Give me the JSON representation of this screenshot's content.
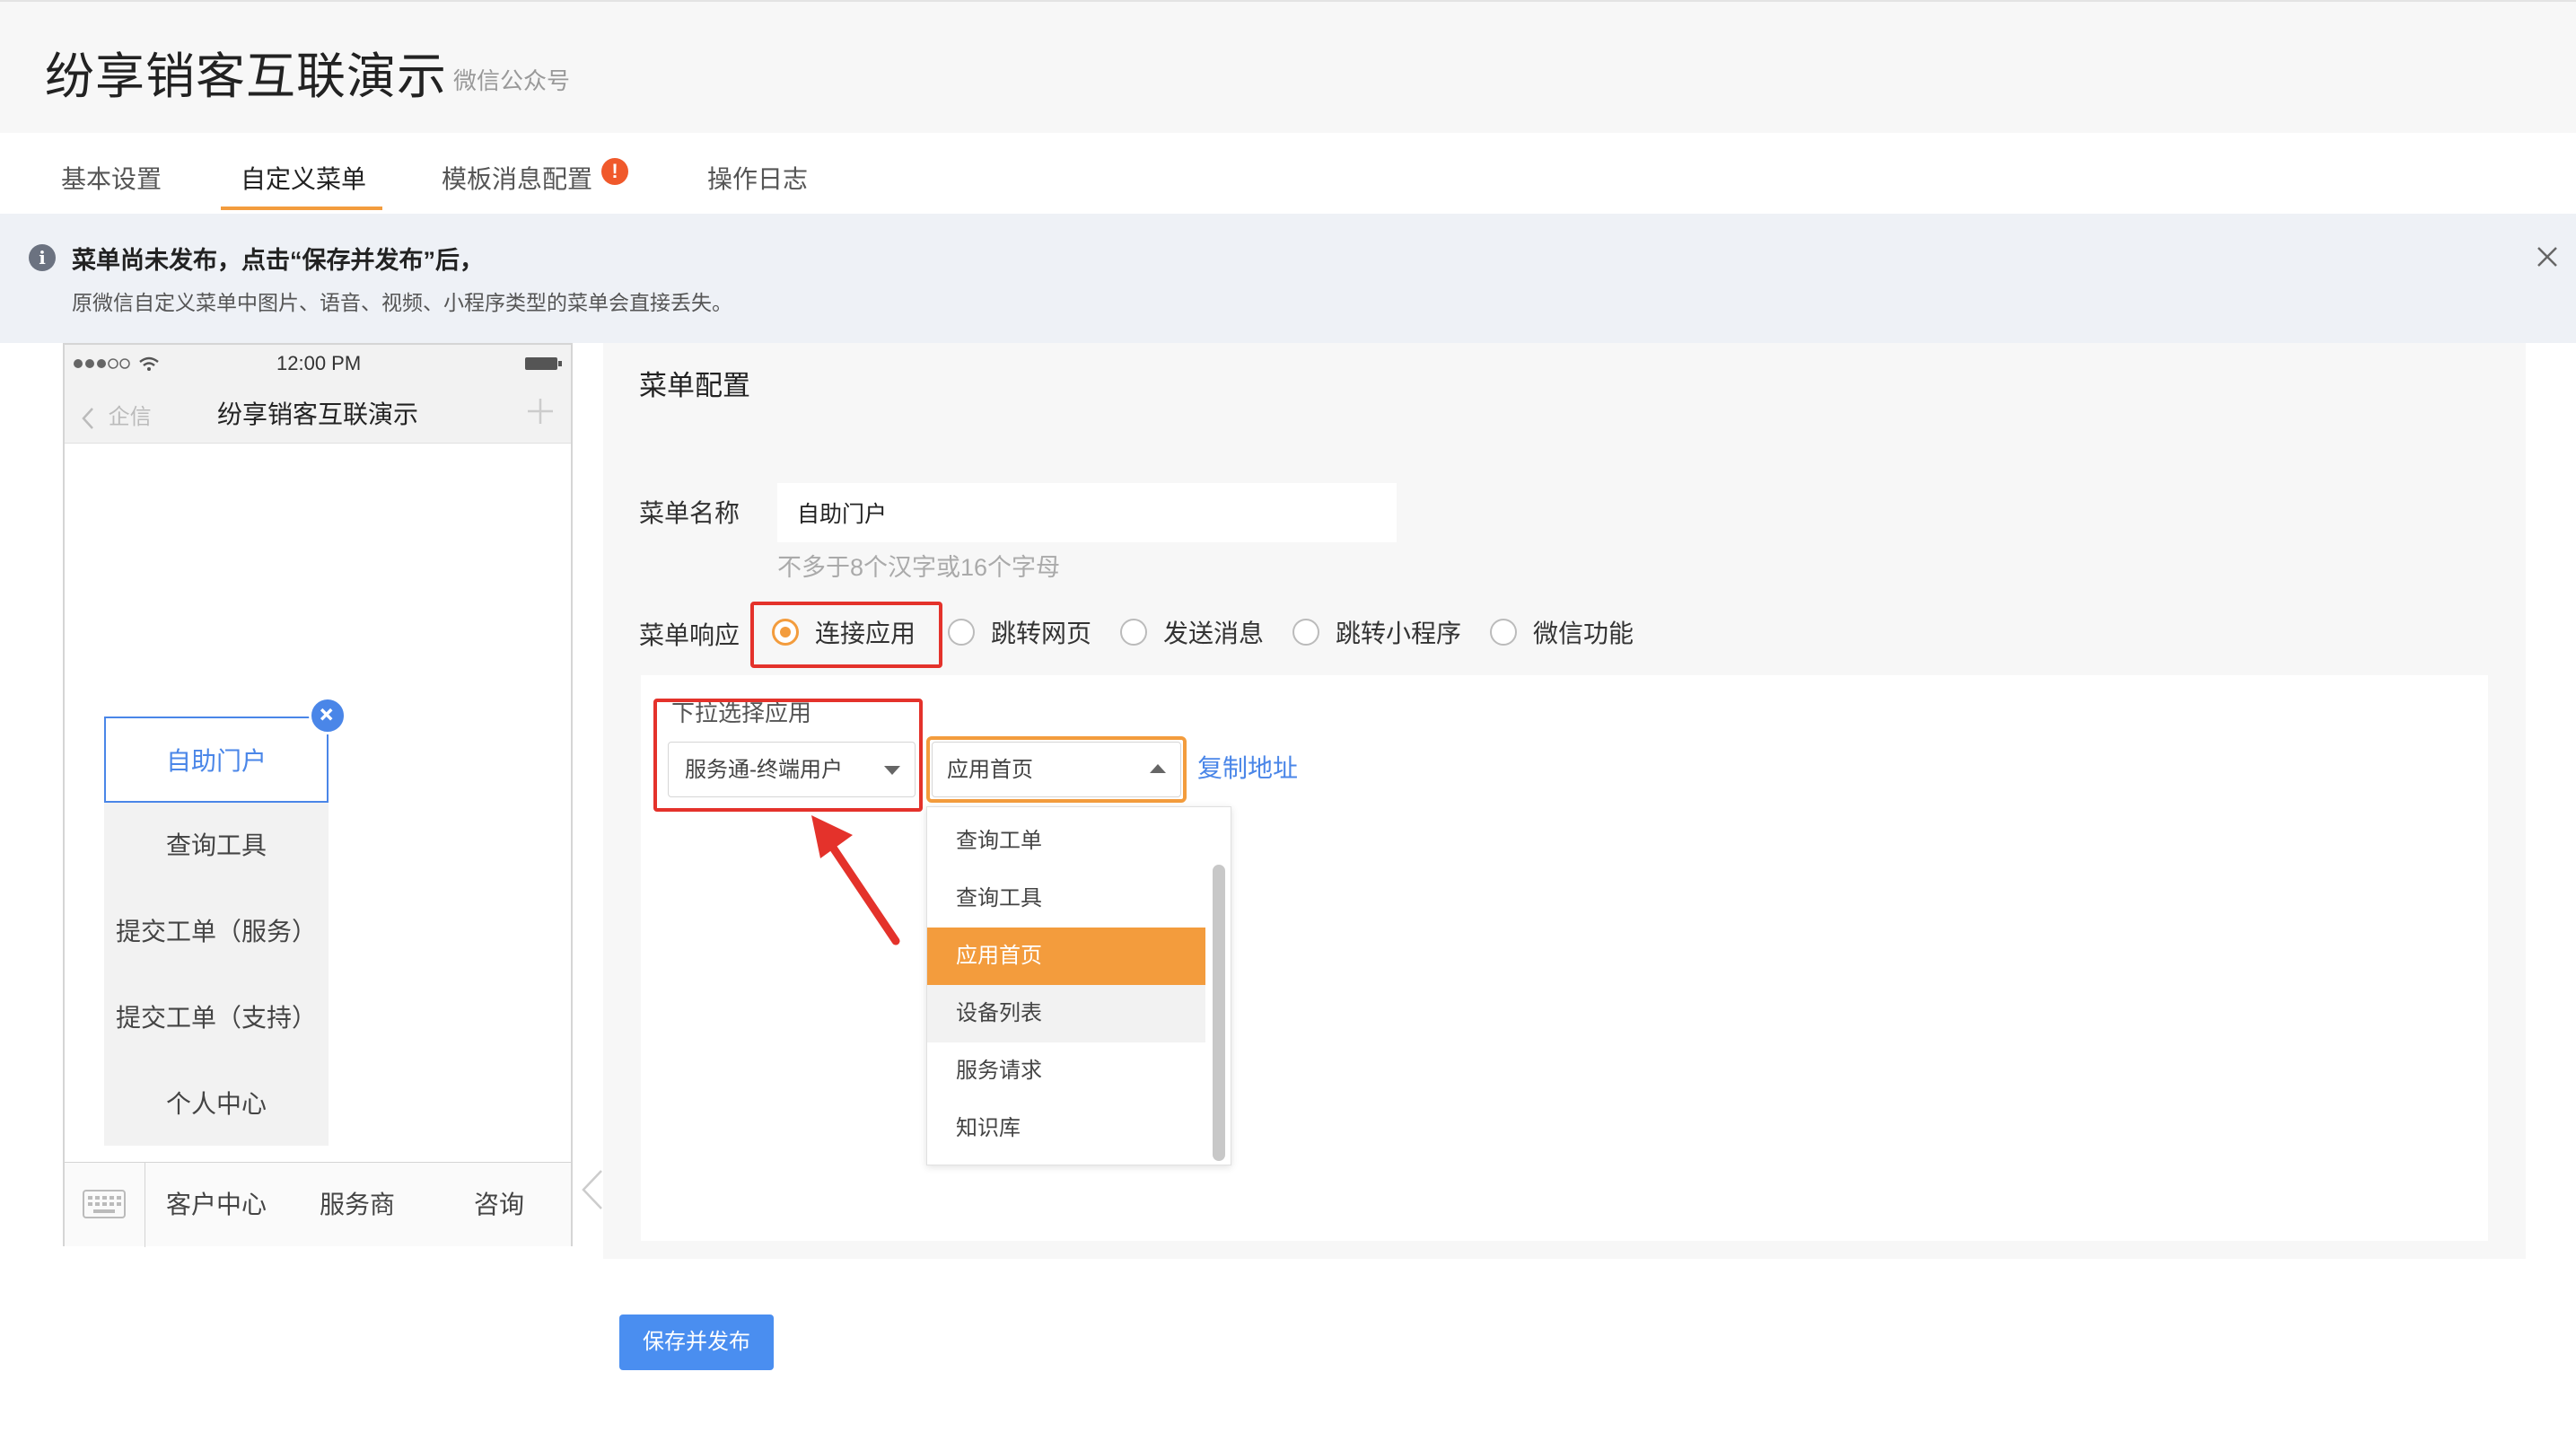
{
  "header": {
    "title": "纷享销客互联演示",
    "subtitle": "微信公众号"
  },
  "tabs": [
    {
      "label": "基本设置"
    },
    {
      "label": "自定义菜单",
      "active": true
    },
    {
      "label": "模板消息配置",
      "badge": "!"
    },
    {
      "label": "操作日志"
    }
  ],
  "alert": {
    "icon": "info-icon",
    "title": "菜单尚未发布，点击“保存并发布”后，",
    "desc": "原微信自定义菜单中图片、语音、视频、小程序类型的菜单会直接丢失。"
  },
  "phone": {
    "time": "12:00 PM",
    "back": "企信",
    "title": "纷享销客互联演示",
    "submenu": [
      "自助门户",
      "查询工具",
      "提交工单（服务）",
      "提交工单（支持）",
      "个人中心"
    ],
    "bottom_menu": [
      "客户中心",
      "服务商",
      "咨询"
    ]
  },
  "config": {
    "title": "菜单配置",
    "name_label": "菜单名称",
    "name_value": "自助门户",
    "name_hint": "不多于8个汉字或16个字母",
    "response_label": "菜单响应",
    "response_options": [
      "连接应用",
      "跳转网页",
      "发送消息",
      "跳转小程序",
      "微信功能"
    ],
    "response_selected": "连接应用",
    "dropdown_label": "下拉选择应用",
    "app_select": "服务通-终端用户",
    "page_select": "应用首页",
    "copy_link": "复制地址",
    "page_options": [
      "查询工单",
      "查询工具",
      "应用首页",
      "设备列表",
      "服务请求",
      "知识库"
    ]
  },
  "save_button": "保存并发布",
  "colors": {
    "accent": "#f39c3d",
    "link": "#4a86e8",
    "annotation_red": "#e4322b",
    "primary_button": "#4a8ef0"
  }
}
